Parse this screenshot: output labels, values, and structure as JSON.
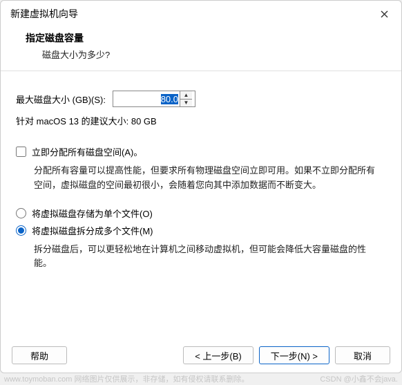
{
  "window": {
    "title": "新建虚拟机向导"
  },
  "header": {
    "title": "指定磁盘容量",
    "subtitle": "磁盘大小为多少?"
  },
  "disk": {
    "max_label": "最大磁盘大小 (GB)(S):",
    "max_value": "80.0",
    "suggest_text": "针对 macOS 13 的建议大小: 80 GB"
  },
  "allocate": {
    "label": "立即分配所有磁盘空间(A)。",
    "desc": "分配所有容量可以提高性能，但要求所有物理磁盘空间立即可用。如果不立即分配所有空间，虚拟磁盘的空间最初很小，会随着您向其中添加数据而不断变大。"
  },
  "store": {
    "single_label": "将虚拟磁盘存储为单个文件(O)",
    "split_label": "将虚拟磁盘拆分成多个文件(M)",
    "split_desc": "拆分磁盘后，可以更轻松地在计算机之间移动虚拟机，但可能会降低大容量磁盘的性能。"
  },
  "buttons": {
    "help": "帮助",
    "back": "< 上一步(B)",
    "next": "下一步(N) >",
    "cancel": "取消"
  },
  "watermark": {
    "left": "www.toymoban.com 网络图片仅供展示，非存储，如有侵权请联系删除。",
    "right": "CSDN @小鑫不会java."
  }
}
